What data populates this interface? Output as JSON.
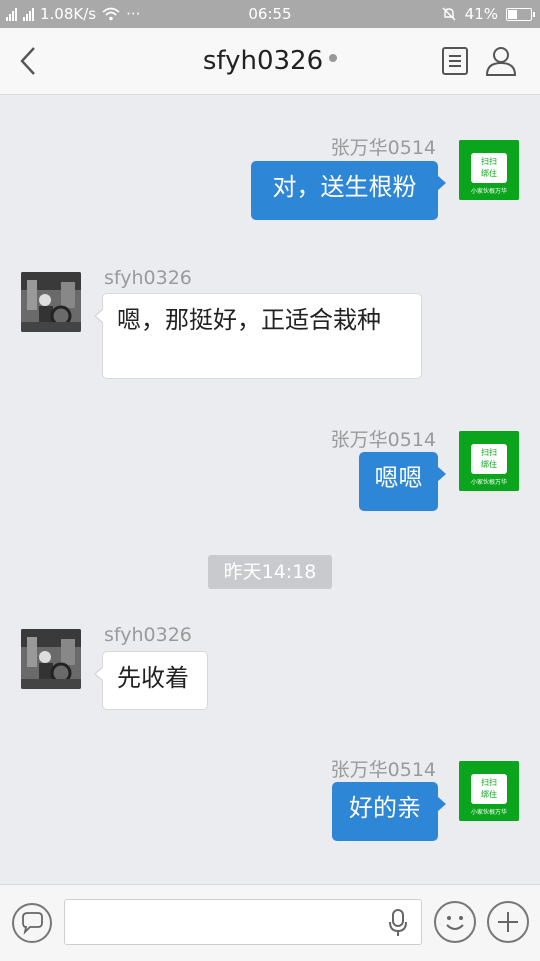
{
  "status_bar": {
    "net_speed": "1.08K/s",
    "dots": "···",
    "time": "06:55",
    "battery_pct": "41%",
    "battery_level": 0.41
  },
  "header": {
    "title": "sfyh0326"
  },
  "messages": [
    {
      "side": "me",
      "sender": "张万华0514",
      "text": "对，送生根粉"
    },
    {
      "side": "them",
      "sender": "sfyh0326",
      "text": "嗯，那挺好，正适合栽种"
    },
    {
      "side": "me",
      "sender": "张万华0514",
      "text": "嗯嗯"
    },
    {
      "side": "them",
      "sender": "sfyh0326",
      "text": "先收着"
    },
    {
      "side": "me",
      "sender": "张万华0514",
      "text": "好的亲"
    }
  ],
  "timestamp": "昨天14:18",
  "avatar_me": {
    "line1": "扫扫",
    "line2": "绑住",
    "line3": "小家伙根万华"
  },
  "bottom_bar": {
    "input_placeholder": ""
  },
  "colors": {
    "my_bubble": "#2e86d6",
    "their_bubble": "#ffffff",
    "background": "#ebecf0",
    "avatar_green": "#0aa51c"
  }
}
